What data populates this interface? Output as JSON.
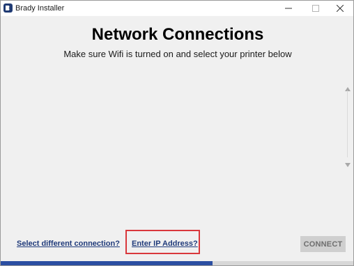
{
  "window": {
    "title": "Brady Installer",
    "controls": {
      "minimize_icon": "minimize-icon",
      "maximize_icon": "maximize-icon",
      "close_icon": "close-icon"
    }
  },
  "main": {
    "heading": "Network Connections",
    "subheading": "Make sure Wifi is turned on and select your printer below",
    "printer_list": []
  },
  "footer": {
    "select_connection_link": "Select different connection?",
    "enter_ip_link": "Enter IP Address?",
    "connect_button": "CONNECT"
  },
  "progress": {
    "fraction": 0.6
  },
  "colors": {
    "accent": "#2b4ea2",
    "link": "#1f3a7a",
    "highlight": "#d9373b",
    "disabled_button": "#cfcfcf"
  }
}
